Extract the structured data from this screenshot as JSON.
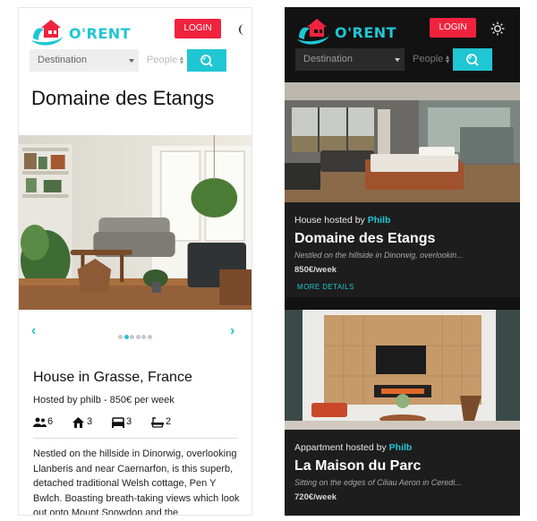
{
  "brand": {
    "name": "O'RENT",
    "accent": "#1fc6d3",
    "login_color": "#f0233f"
  },
  "light": {
    "login_label": "LOGIN",
    "theme_icon": "moon-icon",
    "search": {
      "destination": "Destination",
      "people_placeholder": "People"
    },
    "property": {
      "title": "Domaine des Etangs",
      "carousel": {
        "prev": "‹",
        "next": "›",
        "slide_count": 6,
        "active_slide": 2
      },
      "card_title": "House in Grasse, France",
      "hosted_line": "Hosted by philb - 850€ per week",
      "amenities": [
        {
          "icon": "guests-icon",
          "value": "6"
        },
        {
          "icon": "house-icon",
          "value": "3"
        },
        {
          "icon": "bed-icon",
          "value": "3"
        },
        {
          "icon": "bath-icon",
          "value": "2"
        }
      ],
      "description": "Nestled on the hillside in Dinorwig, overlooking Llanberis and near Caernarfon, is this superb, detached traditional Welsh cottage, Pen Y Bwlch. Boasting breath-taking views which look out onto Mount Snowdon and the"
    }
  },
  "dark": {
    "login_label": "LOGIN",
    "theme_icon": "sun-icon",
    "search": {
      "destination": "Destination",
      "people_placeholder": "People"
    },
    "listings": [
      {
        "hosted_prefix": "House hosted by",
        "host": "Philb",
        "title": "Domaine des Etangs",
        "subtitle": "Nestled on the hillside in Dinorwig, overlookin...",
        "price": "850€/week",
        "link": "MORE DETAILS"
      },
      {
        "hosted_prefix": "Appartment hosted by",
        "host": "Philb",
        "title": "La Maison du Parc",
        "subtitle": "Sitting on the edges of Ciliau Aeron in Ceredi...",
        "price": "720€/week"
      }
    ]
  }
}
